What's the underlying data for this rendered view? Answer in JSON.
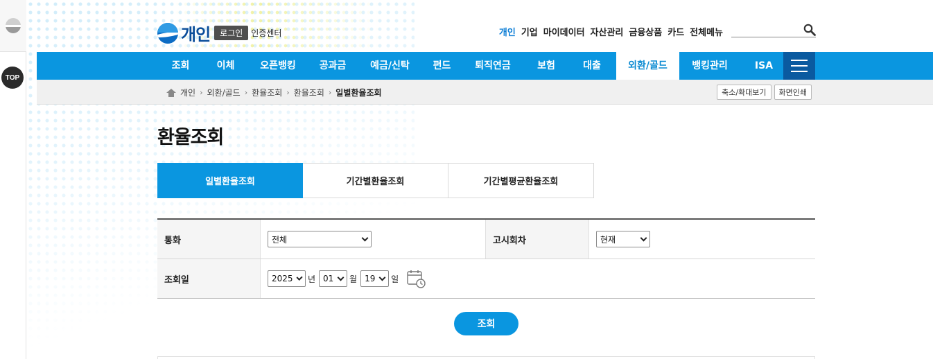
{
  "header": {
    "logo_text": "개인",
    "login_label": "로그인",
    "cert_label": "인증센터",
    "topnav": [
      "개인",
      "기업",
      "마이데이터",
      "자산관리",
      "금융상품",
      "카드",
      "전체메뉴"
    ],
    "topnav_active": 0,
    "search_placeholder": ""
  },
  "rail": {
    "top_label": "TOP"
  },
  "gnb": {
    "items": [
      {
        "label": "조회",
        "w": 67
      },
      {
        "label": "이체",
        "w": 63
      },
      {
        "label": "오픈뱅킹",
        "w": 88
      },
      {
        "label": "공과금",
        "w": 70
      },
      {
        "label": "예금/신탁",
        "w": 95
      },
      {
        "label": "펀드",
        "w": 55
      },
      {
        "label": "퇴직연금",
        "w": 92
      },
      {
        "label": "보험",
        "w": 62
      },
      {
        "label": "대출",
        "w": 70
      },
      {
        "label": "외환/골드",
        "w": 91
      },
      {
        "label": "뱅킹관리",
        "w": 88
      },
      {
        "label": "ISA",
        "w": 68
      }
    ],
    "active_label": "외환/골드"
  },
  "breadcrumb": [
    "개인",
    "외환/골드",
    "환율조회",
    "환율조회",
    "일별환율조회"
  ],
  "util": {
    "zoom_label": "축소/확대보기",
    "print_label": "화면인쇄"
  },
  "page_title": "환율조회",
  "tabs": [
    "일별환율조회",
    "기간별환율조회",
    "기간별평균환율조회"
  ],
  "form": {
    "currency_label": "통화",
    "currency_value": "전체",
    "notice_label": "고시회차",
    "notice_value": "현재",
    "date_label": "조회일",
    "year": "2025",
    "year_unit": "년",
    "month": "01",
    "month_unit": "월",
    "day": "19",
    "day_unit": "일"
  },
  "search_button": "조회",
  "colors": {
    "primary": "#0a96e0",
    "hamburger": "#0a5aa0"
  }
}
